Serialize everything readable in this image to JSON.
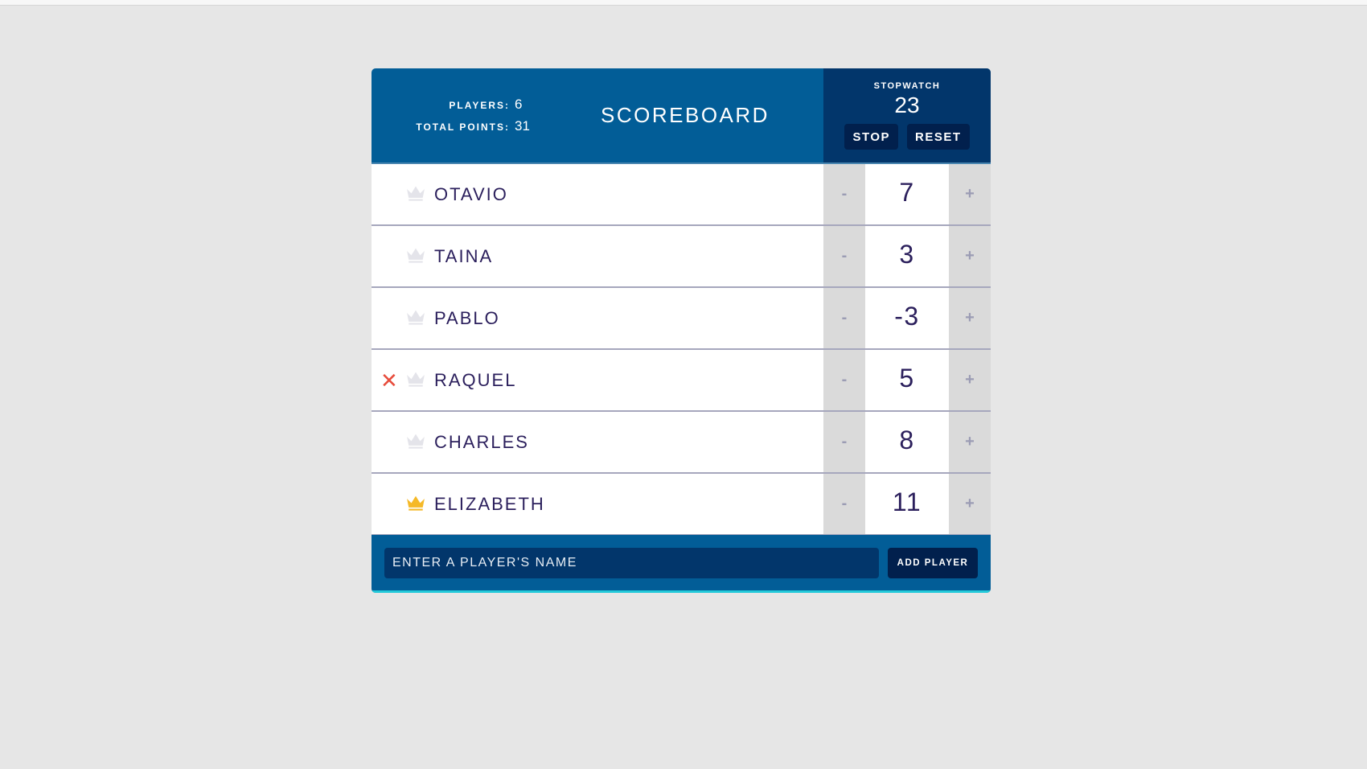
{
  "colors": {
    "header_bg": "#025d97",
    "stopwatch_bg": "#02366b",
    "button_bg": "#01204d",
    "text_dark": "#2b1f5c",
    "crown_inactive": "#e4e4ea",
    "crown_leader": "#f5b928",
    "remove_red": "#e74c3c",
    "footer_accent": "#23c9d9",
    "page_bg": "#e6e6e6"
  },
  "header": {
    "players_label": "PLAYERS:",
    "players_value": "6",
    "total_points_label": "TOTAL POINTS:",
    "total_points_value": "31",
    "title": "SCOREBOARD"
  },
  "stopwatch": {
    "label": "STOPWATCH",
    "time": "23",
    "stop_label": "STOP",
    "reset_label": "RESET"
  },
  "players": [
    {
      "name": "OTAVIO",
      "score": "7",
      "leader": false,
      "remove_visible": false,
      "decrement_label": "-",
      "increment_label": "+"
    },
    {
      "name": "TAINA",
      "score": "3",
      "leader": false,
      "remove_visible": false,
      "decrement_label": "-",
      "increment_label": "+"
    },
    {
      "name": "PABLO",
      "score": "-3",
      "leader": false,
      "remove_visible": false,
      "decrement_label": "-",
      "increment_label": "+"
    },
    {
      "name": "RAQUEL",
      "score": "5",
      "leader": false,
      "remove_visible": true,
      "decrement_label": "-",
      "increment_label": "+"
    },
    {
      "name": "CHARLES",
      "score": "8",
      "leader": false,
      "remove_visible": false,
      "decrement_label": "-",
      "increment_label": "+"
    },
    {
      "name": "ELIZABETH",
      "score": "11",
      "leader": true,
      "remove_visible": false,
      "decrement_label": "-",
      "increment_label": "+"
    }
  ],
  "remove_icon_glyph": "✕",
  "add_player_form": {
    "input_value": "",
    "input_placeholder": "ENTER A PLAYER'S NAME",
    "button_label": "ADD PLAYER"
  }
}
